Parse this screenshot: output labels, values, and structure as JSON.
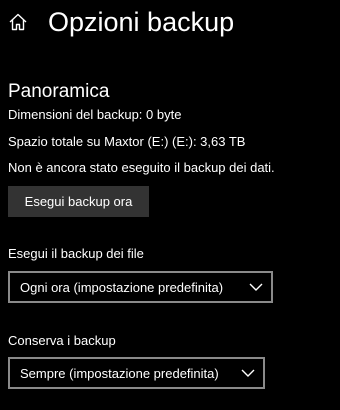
{
  "header": {
    "home_icon": "home-icon",
    "title": "Opzioni backup"
  },
  "overview": {
    "heading": "Panoramica",
    "backup_size": "Dimensioni del backup: 0 byte",
    "total_space": "Spazio totale su Maxtor (E:) (E:): 3,63 TB",
    "status": "Non è ancora stato eseguito il backup dei dati.",
    "backup_now_label": "Esegui backup ora"
  },
  "frequency": {
    "label": "Esegui il backup dei file",
    "selected": "Ogni ora (impostazione predefinita)",
    "icon": "chevron-down-icon"
  },
  "retention": {
    "label": "Conserva i backup",
    "selected": "Sempre (impostazione predefinita)",
    "icon": "chevron-down-icon"
  },
  "colors": {
    "background": "#000000",
    "text": "#ffffff",
    "button_background": "#333333",
    "dropdown_border": "#8a8a8a"
  }
}
